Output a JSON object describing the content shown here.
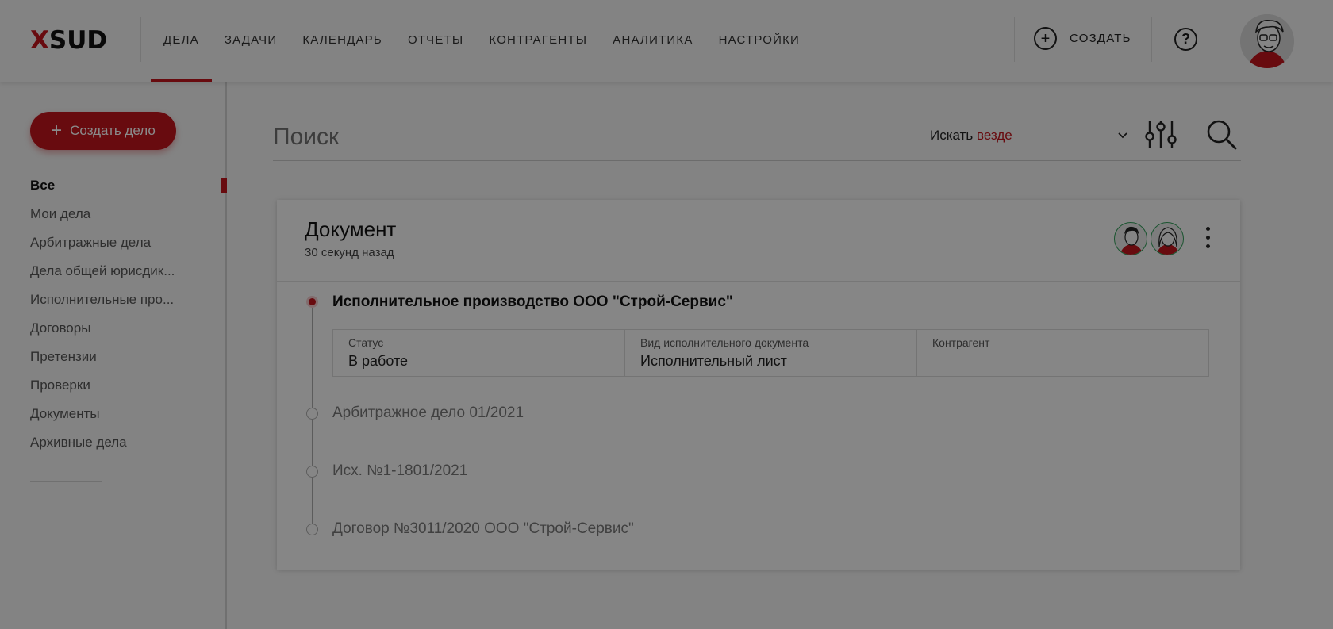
{
  "header": {
    "logo": {
      "x": "X",
      "rest": "SUD"
    },
    "nav": [
      {
        "label": "ДЕЛА",
        "active": true
      },
      {
        "label": "ЗАДАЧИ"
      },
      {
        "label": "КАЛЕНДАРЬ"
      },
      {
        "label": "ОТЧЕТЫ"
      },
      {
        "label": "КОНТРАГЕНТЫ"
      },
      {
        "label": "АНАЛИТИКА"
      },
      {
        "label": "НАСТРОЙКИ"
      }
    ],
    "create_label": "СОЗДАТЬ",
    "create_icon": "plus-circle-icon",
    "help_label": "?",
    "help_icon": "help-circle-icon",
    "avatar_icon": "user-avatar"
  },
  "sidebar": {
    "create_button": {
      "icon": "+",
      "label": "Создать дело"
    },
    "items": [
      {
        "label": "Все",
        "active": true
      },
      {
        "label": "Мои дела"
      },
      {
        "label": "Арбитражные дела"
      },
      {
        "label": "Дела общей юрисдик..."
      },
      {
        "label": "Исполнительные про..."
      },
      {
        "label": "Договоры"
      },
      {
        "label": "Претензии"
      },
      {
        "label": "Проверки"
      },
      {
        "label": "Документы"
      },
      {
        "label": "Архивные дела"
      }
    ]
  },
  "search": {
    "placeholder": "Поиск",
    "scope_prefix": "Искать",
    "scope_value": "везде",
    "scope_icon": "chevron-down-icon",
    "filter_icon": "sliders-icon",
    "search_icon": "search-icon"
  },
  "card": {
    "title": "Документ",
    "subtitle": "30 секунд назад",
    "main_item": "Исполнительное производство ООО \"Строй-Сервис\"",
    "fields": [
      {
        "label": "Статус",
        "value": "В работе"
      },
      {
        "label": "Вид исполнительного документа",
        "value": "Исполнительный лист"
      },
      {
        "label": "Контрагент",
        "value": ""
      }
    ],
    "items": [
      "Арбитражное дело 01/2021",
      "Исх. №1-1801/2021",
      "Договор №3011/2020 ООО \"Строй-Сервис\""
    ]
  },
  "colors": {
    "accent": "#c0161d",
    "background": "#f2f2f2",
    "overlay": "rgba(0,0,0,0.46)"
  }
}
